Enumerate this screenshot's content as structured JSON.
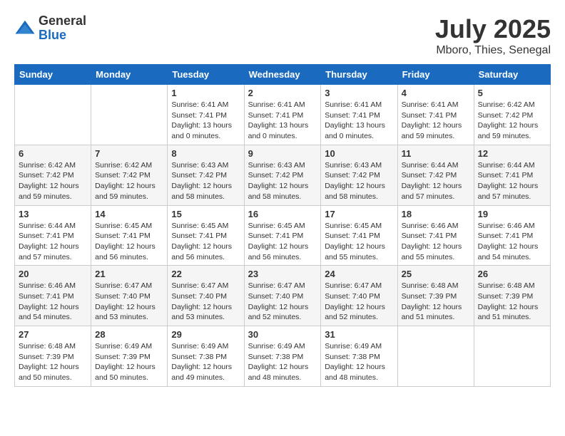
{
  "logo": {
    "general": "General",
    "blue": "Blue"
  },
  "title": "July 2025",
  "location": "Mboro, Thies, Senegal",
  "days_of_week": [
    "Sunday",
    "Monday",
    "Tuesday",
    "Wednesday",
    "Thursday",
    "Friday",
    "Saturday"
  ],
  "weeks": [
    [
      {
        "day": "",
        "info": ""
      },
      {
        "day": "",
        "info": ""
      },
      {
        "day": "1",
        "info": "Sunrise: 6:41 AM\nSunset: 7:41 PM\nDaylight: 13 hours and 0 minutes."
      },
      {
        "day": "2",
        "info": "Sunrise: 6:41 AM\nSunset: 7:41 PM\nDaylight: 13 hours and 0 minutes."
      },
      {
        "day": "3",
        "info": "Sunrise: 6:41 AM\nSunset: 7:41 PM\nDaylight: 13 hours and 0 minutes."
      },
      {
        "day": "4",
        "info": "Sunrise: 6:41 AM\nSunset: 7:41 PM\nDaylight: 12 hours and 59 minutes."
      },
      {
        "day": "5",
        "info": "Sunrise: 6:42 AM\nSunset: 7:42 PM\nDaylight: 12 hours and 59 minutes."
      }
    ],
    [
      {
        "day": "6",
        "info": "Sunrise: 6:42 AM\nSunset: 7:42 PM\nDaylight: 12 hours and 59 minutes."
      },
      {
        "day": "7",
        "info": "Sunrise: 6:42 AM\nSunset: 7:42 PM\nDaylight: 12 hours and 59 minutes."
      },
      {
        "day": "8",
        "info": "Sunrise: 6:43 AM\nSunset: 7:42 PM\nDaylight: 12 hours and 58 minutes."
      },
      {
        "day": "9",
        "info": "Sunrise: 6:43 AM\nSunset: 7:42 PM\nDaylight: 12 hours and 58 minutes."
      },
      {
        "day": "10",
        "info": "Sunrise: 6:43 AM\nSunset: 7:42 PM\nDaylight: 12 hours and 58 minutes."
      },
      {
        "day": "11",
        "info": "Sunrise: 6:44 AM\nSunset: 7:42 PM\nDaylight: 12 hours and 57 minutes."
      },
      {
        "day": "12",
        "info": "Sunrise: 6:44 AM\nSunset: 7:41 PM\nDaylight: 12 hours and 57 minutes."
      }
    ],
    [
      {
        "day": "13",
        "info": "Sunrise: 6:44 AM\nSunset: 7:41 PM\nDaylight: 12 hours and 57 minutes."
      },
      {
        "day": "14",
        "info": "Sunrise: 6:45 AM\nSunset: 7:41 PM\nDaylight: 12 hours and 56 minutes."
      },
      {
        "day": "15",
        "info": "Sunrise: 6:45 AM\nSunset: 7:41 PM\nDaylight: 12 hours and 56 minutes."
      },
      {
        "day": "16",
        "info": "Sunrise: 6:45 AM\nSunset: 7:41 PM\nDaylight: 12 hours and 56 minutes."
      },
      {
        "day": "17",
        "info": "Sunrise: 6:45 AM\nSunset: 7:41 PM\nDaylight: 12 hours and 55 minutes."
      },
      {
        "day": "18",
        "info": "Sunrise: 6:46 AM\nSunset: 7:41 PM\nDaylight: 12 hours and 55 minutes."
      },
      {
        "day": "19",
        "info": "Sunrise: 6:46 AM\nSunset: 7:41 PM\nDaylight: 12 hours and 54 minutes."
      }
    ],
    [
      {
        "day": "20",
        "info": "Sunrise: 6:46 AM\nSunset: 7:41 PM\nDaylight: 12 hours and 54 minutes."
      },
      {
        "day": "21",
        "info": "Sunrise: 6:47 AM\nSunset: 7:40 PM\nDaylight: 12 hours and 53 minutes."
      },
      {
        "day": "22",
        "info": "Sunrise: 6:47 AM\nSunset: 7:40 PM\nDaylight: 12 hours and 53 minutes."
      },
      {
        "day": "23",
        "info": "Sunrise: 6:47 AM\nSunset: 7:40 PM\nDaylight: 12 hours and 52 minutes."
      },
      {
        "day": "24",
        "info": "Sunrise: 6:47 AM\nSunset: 7:40 PM\nDaylight: 12 hours and 52 minutes."
      },
      {
        "day": "25",
        "info": "Sunrise: 6:48 AM\nSunset: 7:39 PM\nDaylight: 12 hours and 51 minutes."
      },
      {
        "day": "26",
        "info": "Sunrise: 6:48 AM\nSunset: 7:39 PM\nDaylight: 12 hours and 51 minutes."
      }
    ],
    [
      {
        "day": "27",
        "info": "Sunrise: 6:48 AM\nSunset: 7:39 PM\nDaylight: 12 hours and 50 minutes."
      },
      {
        "day": "28",
        "info": "Sunrise: 6:49 AM\nSunset: 7:39 PM\nDaylight: 12 hours and 50 minutes."
      },
      {
        "day": "29",
        "info": "Sunrise: 6:49 AM\nSunset: 7:38 PM\nDaylight: 12 hours and 49 minutes."
      },
      {
        "day": "30",
        "info": "Sunrise: 6:49 AM\nSunset: 7:38 PM\nDaylight: 12 hours and 48 minutes."
      },
      {
        "day": "31",
        "info": "Sunrise: 6:49 AM\nSunset: 7:38 PM\nDaylight: 12 hours and 48 minutes."
      },
      {
        "day": "",
        "info": ""
      },
      {
        "day": "",
        "info": ""
      }
    ]
  ]
}
